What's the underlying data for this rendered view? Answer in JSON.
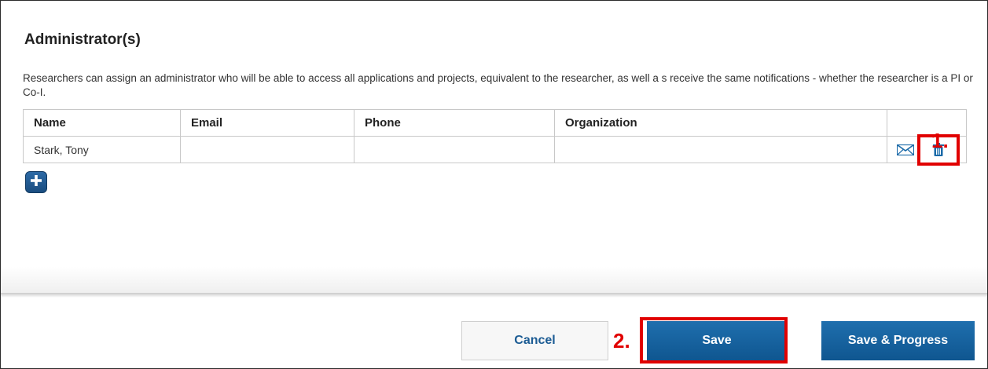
{
  "section": {
    "title": "Administrator(s)",
    "description": "Researchers can assign an administrator who will be able to access all applications and projects, equivalent to the researcher, as well a s receive the same notifications - whether the researcher is a PI or Co-I."
  },
  "table": {
    "columns": [
      "Name",
      "Email",
      "Phone",
      "Organization",
      ""
    ],
    "rows": [
      {
        "name": "Stark, Tony",
        "email": "",
        "phone": "",
        "organization": ""
      }
    ]
  },
  "icons": {
    "mail": "mail-icon",
    "delete": "trash-icon",
    "add": "plus-icon"
  },
  "annotations": {
    "step1": "1.",
    "step2": "2.",
    "highlight_color": "#e10000"
  },
  "footer": {
    "cancel_label": "Cancel",
    "save_label": "Save",
    "save_progress_label": "Save & Progress"
  },
  "colors": {
    "primary_button": "#1565a0",
    "link_text": "#1c5c94"
  }
}
